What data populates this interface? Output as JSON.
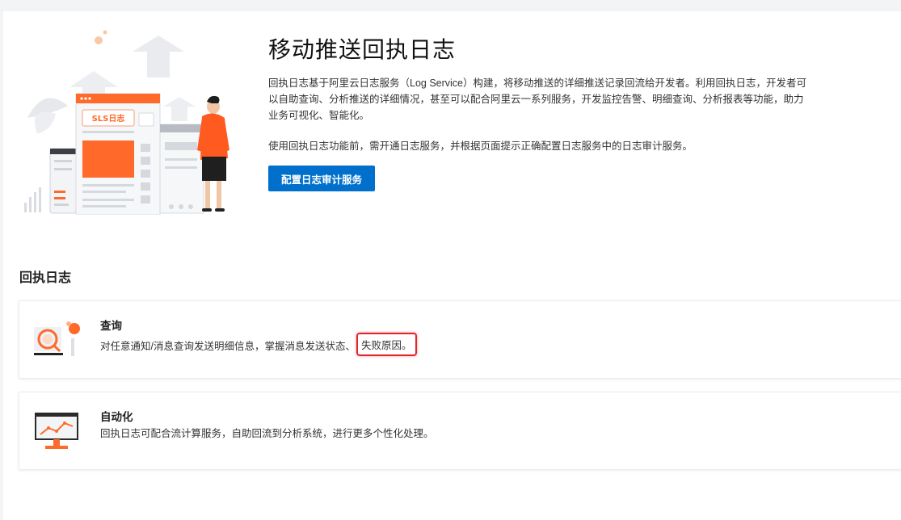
{
  "hero": {
    "title": "移动推送回执日志",
    "description": "回执日志基于阿里云日志服务（Log Service）构建，将移动推送的详细推送记录回流给开发者。利用回执日志，开发者可以自助查询、分析推送的详细情况，甚至可以配合阿里云一系列服务，开发监控告警、明细查询、分析报表等功能，助力业务可视化、智能化。",
    "note": "使用回执日志功能前，需开通日志服务，并根据页面提示正确配置日志服务中的日志审计服务。",
    "button_label": "配置日志审计服务",
    "illustration_label": "SLS日志"
  },
  "section": {
    "title": "回执日志"
  },
  "cards": [
    {
      "title": "查询",
      "description": "对任意通知/消息查询发送明细信息，掌握消息发送状态、",
      "highlight": "失败原因。",
      "icon": "search-magnifier-icon"
    },
    {
      "title": "自动化",
      "description": "回执日志可配合流计算服务，自助回流到分析系统，进行更多个性化处理。",
      "icon": "monitor-chart-icon"
    }
  ],
  "colors": {
    "primary": "#0070cc",
    "accent_orange": "#ff6a2b",
    "highlight_red": "#e0262d"
  }
}
